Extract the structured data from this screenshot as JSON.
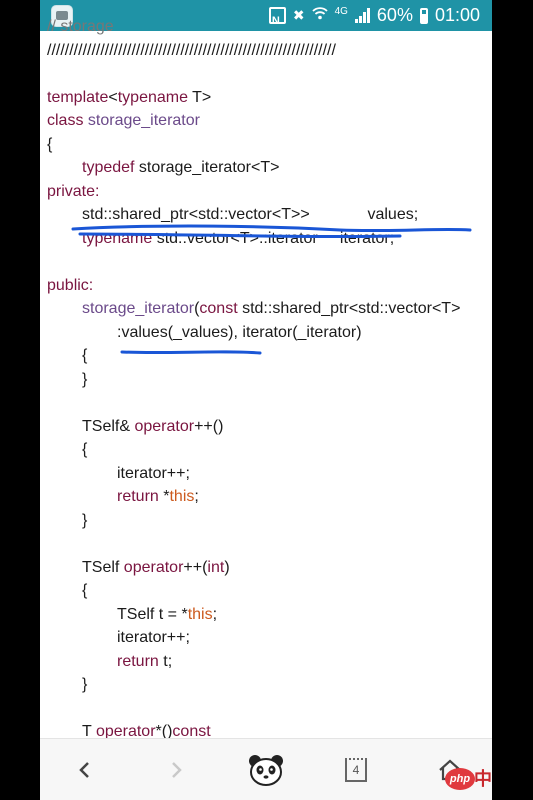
{
  "status_bar": {
    "network_type": "4G",
    "battery_percent": "60%",
    "time": "01:00",
    "icons": [
      "app-notification-icon",
      "nfc-icon",
      "mute-icon",
      "wifi-icon",
      "signal-icon",
      "battery-icon"
    ]
  },
  "code": {
    "lines": [
      {
        "indent": 0,
        "parts": [
          {
            "t": "// storage",
            "c": "cm"
          }
        ]
      },
      {
        "indent": 0,
        "parts": [
          {
            "t": "/////////////////////////////////////////////////////////////////",
            "c": ""
          }
        ]
      },
      {
        "indent": 0,
        "parts": []
      },
      {
        "indent": 0,
        "parts": [
          {
            "t": "template",
            "c": "kw"
          },
          {
            "t": "<",
            "c": ""
          },
          {
            "t": "typename",
            "c": "kw"
          },
          {
            "t": " T>",
            "c": ""
          }
        ]
      },
      {
        "indent": 0,
        "parts": [
          {
            "t": "class",
            "c": "kw"
          },
          {
            "t": " ",
            "c": ""
          },
          {
            "t": "storage_iterator",
            "c": "fn"
          }
        ]
      },
      {
        "indent": 0,
        "parts": [
          {
            "t": "{",
            "c": ""
          }
        ]
      },
      {
        "indent": 1,
        "parts": [
          {
            "t": "typedef",
            "c": "kw"
          },
          {
            "t": " storage_iterator<T>",
            "c": ""
          }
        ]
      },
      {
        "indent": 0,
        "parts": [
          {
            "t": "private:",
            "c": "kw"
          }
        ]
      },
      {
        "indent": 1,
        "parts": [
          {
            "t": "std::shared_ptr<std::vector<T>>             values;",
            "c": ""
          }
        ]
      },
      {
        "indent": 1,
        "parts": [
          {
            "t": "typename",
            "c": "kw"
          },
          {
            "t": " std::vector<T>::iterator     iterator;",
            "c": ""
          }
        ]
      },
      {
        "indent": 0,
        "parts": []
      },
      {
        "indent": 0,
        "parts": [
          {
            "t": "public:",
            "c": "kw"
          }
        ]
      },
      {
        "indent": 1,
        "parts": [
          {
            "t": "storage_iterator",
            "c": "fn"
          },
          {
            "t": "(",
            "c": ""
          },
          {
            "t": "const",
            "c": "kw"
          },
          {
            "t": " std::shared_ptr<std::vector<T>",
            "c": ""
          }
        ]
      },
      {
        "indent": 2,
        "parts": [
          {
            "t": ":values(_values), iterator(_iterator)",
            "c": ""
          }
        ]
      },
      {
        "indent": 1,
        "parts": [
          {
            "t": "{",
            "c": ""
          }
        ]
      },
      {
        "indent": 1,
        "parts": [
          {
            "t": "}",
            "c": ""
          }
        ]
      },
      {
        "indent": 0,
        "parts": []
      },
      {
        "indent": 1,
        "parts": [
          {
            "t": "TSelf& ",
            "c": ""
          },
          {
            "t": "operator",
            "c": "kw"
          },
          {
            "t": "++()",
            "c": ""
          }
        ]
      },
      {
        "indent": 1,
        "parts": [
          {
            "t": "{",
            "c": ""
          }
        ]
      },
      {
        "indent": 2,
        "parts": [
          {
            "t": "iterator++;",
            "c": ""
          }
        ]
      },
      {
        "indent": 2,
        "parts": [
          {
            "t": "return",
            "c": "kw"
          },
          {
            "t": " *",
            "c": ""
          },
          {
            "t": "this",
            "c": "th"
          },
          {
            "t": ";",
            "c": ""
          }
        ]
      },
      {
        "indent": 1,
        "parts": [
          {
            "t": "}",
            "c": ""
          }
        ]
      },
      {
        "indent": 0,
        "parts": []
      },
      {
        "indent": 1,
        "parts": [
          {
            "t": "TSelf ",
            "c": ""
          },
          {
            "t": "operator",
            "c": "kw"
          },
          {
            "t": "++(",
            "c": ""
          },
          {
            "t": "int",
            "c": "kw"
          },
          {
            "t": ")",
            "c": ""
          }
        ]
      },
      {
        "indent": 1,
        "parts": [
          {
            "t": "{",
            "c": ""
          }
        ]
      },
      {
        "indent": 2,
        "parts": [
          {
            "t": "TSelf t = *",
            "c": ""
          },
          {
            "t": "this",
            "c": "th"
          },
          {
            "t": ";",
            "c": ""
          }
        ]
      },
      {
        "indent": 2,
        "parts": [
          {
            "t": "iterator++;",
            "c": ""
          }
        ]
      },
      {
        "indent": 2,
        "parts": [
          {
            "t": "return",
            "c": "kw"
          },
          {
            "t": " t;",
            "c": ""
          }
        ]
      },
      {
        "indent": 1,
        "parts": [
          {
            "t": "}",
            "c": ""
          }
        ]
      },
      {
        "indent": 0,
        "parts": []
      },
      {
        "indent": 1,
        "parts": [
          {
            "t": "T ",
            "c": ""
          },
          {
            "t": "operator",
            "c": "kw"
          },
          {
            "t": "*()",
            "c": ""
          },
          {
            "t": "const",
            "c": "kw"
          }
        ]
      }
    ]
  },
  "bottom_nav": {
    "back_icon": "chevron-left-icon",
    "forward_icon": "chevron-right-icon",
    "panda_icon": "panda-icon",
    "tabs_count": "4",
    "home_icon": "home-icon",
    "php_logo_text": "php",
    "php_cn_text": "中"
  },
  "annotation_color": "#1a56d6",
  "status_bar_color": "#1f93a6"
}
